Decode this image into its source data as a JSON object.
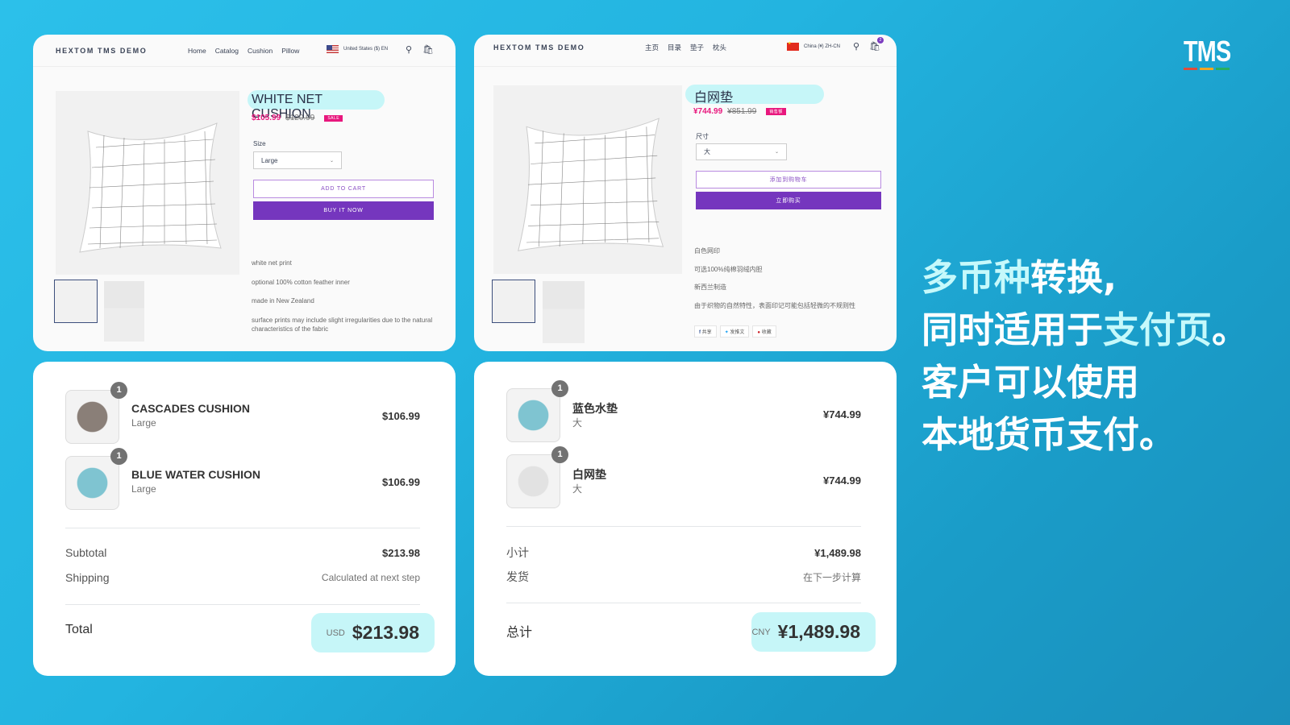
{
  "colors": {
    "accent_purple": "#7536be",
    "sale_pink": "#e8177d",
    "highlight_cyan": "#c6f6f8",
    "logo_bars": [
      "#e14b3b",
      "#f5a623",
      "#27ae60"
    ]
  },
  "en_product": {
    "brand": "HEXTOM TMS DEMO",
    "nav": [
      "Home",
      "Catalog",
      "Cushion",
      "Pillow"
    ],
    "region": "United States ($) EN",
    "title": "WHITE NET CUSHION",
    "price_sale": "$105.99",
    "price_original": "$120.99",
    "sale_badge": "SALE",
    "size_label": "Size",
    "size_value": "Large",
    "add_to_cart": "ADD TO CART",
    "buy_now": "BUY IT NOW",
    "description": [
      "white net print",
      "optional 100% cotton feather inner",
      "made in New Zealand",
      "surface prints may include slight irregularities due to the natural characteristics of the fabric"
    ]
  },
  "cn_product": {
    "brand": "HEXTOM TMS DEMO",
    "nav": [
      "主页",
      "目录",
      "垫子",
      "枕头"
    ],
    "region": "China (¥) ZH-CN",
    "cart_count": "2",
    "title": "白网垫",
    "price_sale": "¥744.99",
    "price_original": "¥851.99",
    "sale_badge": "销售额",
    "size_label": "尺寸",
    "size_value": "大",
    "add_to_cart": "添加到购物车",
    "buy_now": "立即购买",
    "description": [
      "白色网印",
      "可选100%纯棉羽绒内胆",
      "新西兰制造",
      "由于织物的自然特性，表面印记可能包括轻微的不规则性"
    ],
    "share": [
      "共享",
      "发推文",
      "收藏"
    ]
  },
  "en_checkout": {
    "items": [
      {
        "qty": "1",
        "name": "CASCADES CUSHION",
        "variant": "Large",
        "price": "$106.99"
      },
      {
        "qty": "1",
        "name": "BLUE WATER CUSHION",
        "variant": "Large",
        "price": "$106.99"
      }
    ],
    "subtotal_label": "Subtotal",
    "subtotal": "$213.98",
    "shipping_label": "Shipping",
    "shipping": "Calculated at next step",
    "total_label": "Total",
    "currency": "USD",
    "total": "$213.98"
  },
  "cn_checkout": {
    "items": [
      {
        "qty": "1",
        "name": "蓝色水垫",
        "variant": "大",
        "price": "¥744.99"
      },
      {
        "qty": "1",
        "name": "白网垫",
        "variant": "大",
        "price": "¥744.99"
      }
    ],
    "subtotal_label": "小计",
    "subtotal": "¥1,489.98",
    "shipping_label": "发货",
    "shipping": "在下一步计算",
    "total_label": "总计",
    "currency": "CNY",
    "total": "¥1,489.98"
  },
  "headline": {
    "line1_hl": "多币种",
    "line1_rest": "转换,",
    "line2_a": "同时适用于",
    "line2_hl": "支付页",
    "line2_end": "。",
    "line3": "客户可以使用",
    "line4": "本地货币支付。"
  },
  "logo": "TMS"
}
